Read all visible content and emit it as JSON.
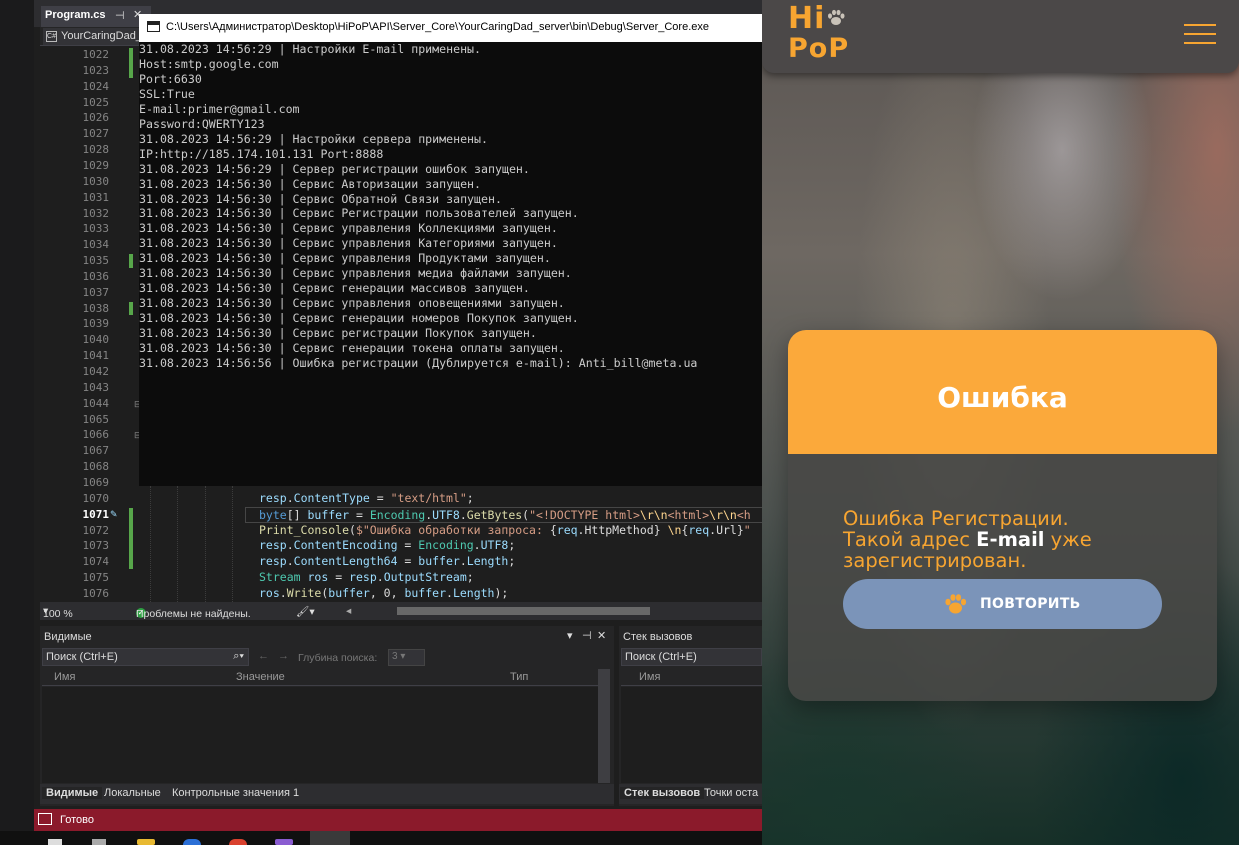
{
  "vs": {
    "tab_title": "Program.cs",
    "nav_combo": "YourCaringDad_",
    "zoom": "100 %",
    "problems": "Проблемы не найдены.",
    "locals_panel": {
      "title": "Видимые",
      "search_placeholder": "Поиск (Ctrl+E)",
      "depth_label": "Глубина поиска:",
      "depth_value": "3",
      "col_name": "Имя",
      "col_value": "Значение",
      "col_type": "Тип",
      "tabs": [
        "Видимые",
        "Локальные",
        "Контрольные значения 1"
      ]
    },
    "callstack_panel": {
      "title": "Стек вызовов",
      "search_placeholder": "Поиск (Ctrl+E)",
      "col_name": "Имя",
      "tabs": [
        "Стек вызовов",
        "Точки оста"
      ]
    },
    "status": "Готово",
    "line_numbers": [
      "1022",
      "1023",
      "1024",
      "1025",
      "1026",
      "1027",
      "1028",
      "1029",
      "1030",
      "1031",
      "1032",
      "1033",
      "1034",
      "1035",
      "1036",
      "1037",
      "1038",
      "1039",
      "1040",
      "1041",
      "1042",
      "1043",
      "1044",
      "1065",
      "1066",
      "1067",
      "1068",
      "1069",
      "1070",
      "1071",
      "1072",
      "1073",
      "1074",
      "1075",
      "1076"
    ],
    "active_line": "1071",
    "code_lines": [
      {
        "n": "1070",
        "tokens": [
          [
            "v",
            "resp"
          ],
          [
            "p",
            "."
          ],
          [
            "v",
            "ContentType"
          ],
          [
            "p",
            " = "
          ],
          [
            "s",
            "\"text/html\""
          ],
          [
            "p",
            ";"
          ]
        ]
      },
      {
        "n": "1071",
        "tokens": [
          [
            "k",
            "byte"
          ],
          [
            "p",
            "[] "
          ],
          [
            "v",
            "buffer"
          ],
          [
            "p",
            " = "
          ],
          [
            "t",
            "Encoding"
          ],
          [
            "p",
            "."
          ],
          [
            "v",
            "UTF8"
          ],
          [
            "p",
            "."
          ],
          [
            "m",
            "GetBytes"
          ],
          [
            "p",
            "("
          ],
          [
            "s",
            "\"<!DOCTYPE html>"
          ],
          [
            "e",
            "\\r\\n"
          ],
          [
            "s",
            "<html>"
          ],
          [
            "e",
            "\\r\\n"
          ],
          [
            "s",
            "<h"
          ]
        ]
      },
      {
        "n": "1072",
        "tokens": [
          [
            "m",
            "Print_Console"
          ],
          [
            "p",
            "("
          ],
          [
            "s",
            "$\"Ошибка обработки запроса: "
          ],
          [
            "p",
            "{"
          ],
          [
            "v",
            "req"
          ],
          [
            "p",
            ".HttpMethod} "
          ],
          [
            "e",
            "\\n"
          ],
          [
            "p",
            "{"
          ],
          [
            "v",
            "req"
          ],
          [
            "p",
            ".Url}"
          ],
          [
            "s",
            "\""
          ]
        ]
      },
      {
        "n": "1073",
        "tokens": [
          [
            "v",
            "resp"
          ],
          [
            "p",
            "."
          ],
          [
            "v",
            "ContentEncoding"
          ],
          [
            "p",
            " = "
          ],
          [
            "t",
            "Encoding"
          ],
          [
            "p",
            "."
          ],
          [
            "v",
            "UTF8"
          ],
          [
            "p",
            ";"
          ]
        ]
      },
      {
        "n": "1074",
        "tokens": [
          [
            "v",
            "resp"
          ],
          [
            "p",
            "."
          ],
          [
            "v",
            "ContentLength64"
          ],
          [
            "p",
            " = "
          ],
          [
            "v",
            "buffer"
          ],
          [
            "p",
            "."
          ],
          [
            "v",
            "Length"
          ],
          [
            "p",
            ";"
          ]
        ]
      },
      {
        "n": "1075",
        "tokens": [
          [
            "t",
            "Stream"
          ],
          [
            "p",
            " "
          ],
          [
            "v",
            "ros"
          ],
          [
            "p",
            " = "
          ],
          [
            "v",
            "resp"
          ],
          [
            "p",
            "."
          ],
          [
            "v",
            "OutputStream"
          ],
          [
            "p",
            ";"
          ]
        ]
      },
      {
        "n": "1076",
        "tokens": [
          [
            "v",
            "ros"
          ],
          [
            "p",
            "."
          ],
          [
            "m",
            "Write"
          ],
          [
            "p",
            "("
          ],
          [
            "v",
            "buffer"
          ],
          [
            "p",
            ", 0, "
          ],
          [
            "v",
            "buffer"
          ],
          [
            "p",
            "."
          ],
          [
            "v",
            "Length"
          ],
          [
            "p",
            ");"
          ]
        ]
      }
    ]
  },
  "console": {
    "title": "C:\\Users\\Администратор\\Desktop\\HiPoP\\API\\Server_Core\\YourCaringDad_server\\bin\\Debug\\Server_Core.exe",
    "lines": [
      "31.08.2023 14:56:29 | Настройки E-mail применены.",
      "Host:smtp.google.com",
      "Port:6630",
      "SSL:True",
      "E-mail:primer@gmail.com",
      "Password:QWERTY123",
      "31.08.2023 14:56:29 | Настройки сервера применены.",
      "IP:http://185.174.101.131 Port:8888",
      "31.08.2023 14:56:29 | Сервер регистрации ошибок запущен.",
      "31.08.2023 14:56:30 | Сервис Авторизации запущен.",
      "31.08.2023 14:56:30 | Сервис Обратной Связи запущен.",
      "31.08.2023 14:56:30 | Сервис Регистрации пользователей запущен.",
      "31.08.2023 14:56:30 | Сервис управления Коллекциями запущен.",
      "31.08.2023 14:56:30 | Сервис управления Категориями запущен.",
      "31.08.2023 14:56:30 | Сервис управления Продуктами запущен.",
      "31.08.2023 14:56:30 | Сервис управления медиа файлами запущен.",
      "31.08.2023 14:56:30 | Сервис генерации массивов запущен.",
      "31.08.2023 14:56:30 | Сервис управления оповещениями запущен.",
      "31.08.2023 14:56:30 | Сервис генерации номеров Покупок запущен.",
      "31.08.2023 14:56:30 | Сервис регистрации Покупок запущен.",
      "31.08.2023 14:56:30 | Сервис генерации токена оплаты запущен.",
      "31.08.2023 14:56:56 | Ошибка регистрации (Дублируется e-mail): Anti_bill@meta.ua"
    ]
  },
  "app": {
    "logo_top": "Hi",
    "logo_bottom": "PoP",
    "modal": {
      "title": "Ошибка",
      "message_line1": "Ошибка Регистрации.",
      "message_pre": "Такой адрес ",
      "message_bold": "E-mail",
      "message_post": " уже",
      "message_line3": "зарегистрирован.",
      "button_label": "ПОВТОРИТЬ"
    },
    "colors": {
      "accent": "#f7a531",
      "modal_header": "#fba93b",
      "button": "#7b94b9",
      "header_bg": "#4b4848"
    }
  }
}
